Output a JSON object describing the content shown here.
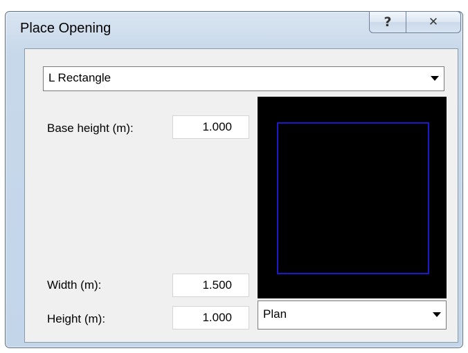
{
  "dialog": {
    "title": "Place Opening",
    "help_glyph": "?",
    "close_glyph": "✕"
  },
  "type_select": {
    "value": "L Rectangle"
  },
  "fields": {
    "base_height": {
      "label": "Base height (m):",
      "value": "1.000"
    },
    "width": {
      "label": "Width (m):",
      "value": "1.500"
    },
    "height": {
      "label": "Height (m):",
      "value": "1.000"
    }
  },
  "preview": {
    "background": "#000000",
    "shape_color": "#1a1acc"
  },
  "view_select": {
    "value": "Plan"
  }
}
